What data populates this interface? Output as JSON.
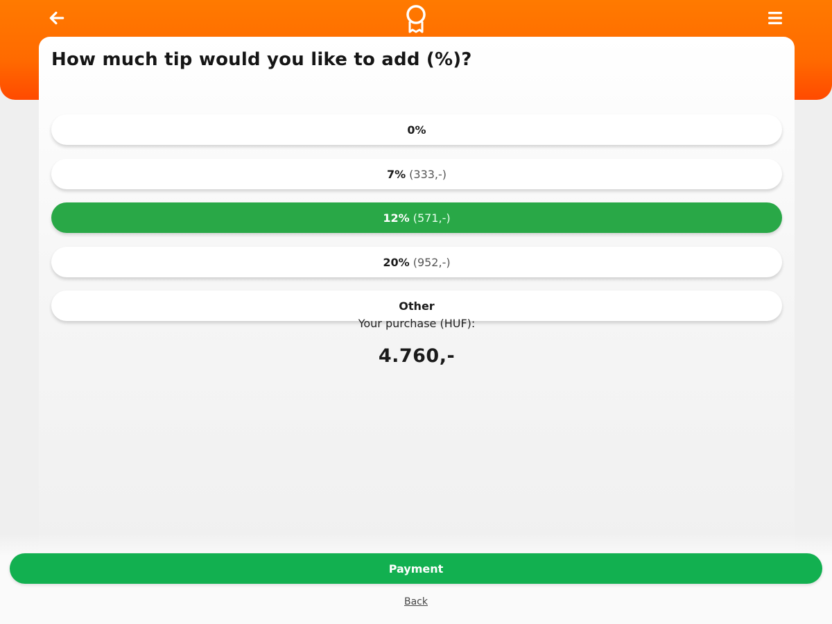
{
  "header": {
    "back_icon": "arrow-left-icon",
    "logo_icon": "award-badge-icon",
    "menu_icon": "hamburger-menu-icon",
    "color": "#ff7000"
  },
  "question": "How much tip would you like to add (%)?",
  "options": [
    {
      "percent": "0%",
      "amount": "",
      "selected": false
    },
    {
      "percent": "7%",
      "amount": "(333,-)",
      "selected": false
    },
    {
      "percent": "12%",
      "amount": "(571,-)",
      "selected": true
    },
    {
      "percent": "20%",
      "amount": "(952,-)",
      "selected": false
    },
    {
      "label": "Other",
      "selected": false
    }
  ],
  "summary": {
    "label": "Your purchase (HUF):",
    "total": "4.760,-"
  },
  "actions": {
    "payment_label": "Payment",
    "back_label": "Back"
  },
  "colors": {
    "selected_option": "#29a847",
    "payment_button": "#12b050"
  }
}
